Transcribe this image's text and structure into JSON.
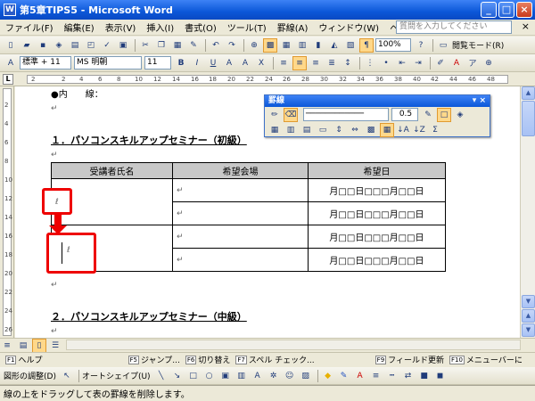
{
  "window": {
    "title": "第5章TIPS5 - Microsoft Word"
  },
  "menu": {
    "items": [
      "ファイル(F)",
      "編集(E)",
      "表示(V)",
      "挿入(I)",
      "書式(O)",
      "ツール(T)",
      "罫線(A)",
      "ウィンドウ(W)",
      "ヘルプ(H)"
    ],
    "help_placeholder": "質問を入力してください",
    "close": "×"
  },
  "toolbar1": {
    "zoom": "100%",
    "reading_mode": "閲覧モード(R)"
  },
  "toolbar2": {
    "style": "標準 + 11",
    "font": "MS 明朝",
    "size": "11"
  },
  "ruler": {
    "ticks": [
      "2",
      "2",
      "4",
      "6",
      "8",
      "10",
      "12",
      "14",
      "16",
      "18",
      "20",
      "22",
      "24",
      "26",
      "28",
      "30",
      "32",
      "34",
      "36",
      "38",
      "40",
      "42",
      "44",
      "46",
      "48"
    ],
    "tab_selector": "L"
  },
  "vruler": {
    "ticks": [
      "2",
      "4",
      "6",
      "8",
      "10",
      "12",
      "14",
      "16",
      "18",
      "20",
      "22",
      "24",
      "26"
    ]
  },
  "document": {
    "first_line": "●内　　線：",
    "heading1": "１．パソコンスキルアップセミナー（初級）",
    "heading2": "２．パソコンスキルアップセミナー（中級）",
    "table": {
      "headers": [
        "受講者氏名",
        "希望会場",
        "希望日"
      ],
      "date_cell": "月□□日□□□月□□日",
      "rows": 4
    }
  },
  "border_palette": {
    "title": "罫線",
    "line_width": "0.5"
  },
  "fkeys": [
    {
      "key": "F1",
      "label": "ヘルプ"
    },
    {
      "key": "F5",
      "label": "ジャンプ..."
    },
    {
      "key": "F6",
      "label": "切り替え"
    },
    {
      "key": "F7",
      "label": "スペル チェック..."
    },
    {
      "key": "F9",
      "label": "フィールド更新"
    },
    {
      "key": "F10",
      "label": "メニューバーに"
    }
  ],
  "drawing": {
    "adjust": "図形の調整(D)",
    "autoshape": "オートシェイプ(U)"
  },
  "status": {
    "text": "線の上をドラッグして表の罫線を削除します。"
  }
}
